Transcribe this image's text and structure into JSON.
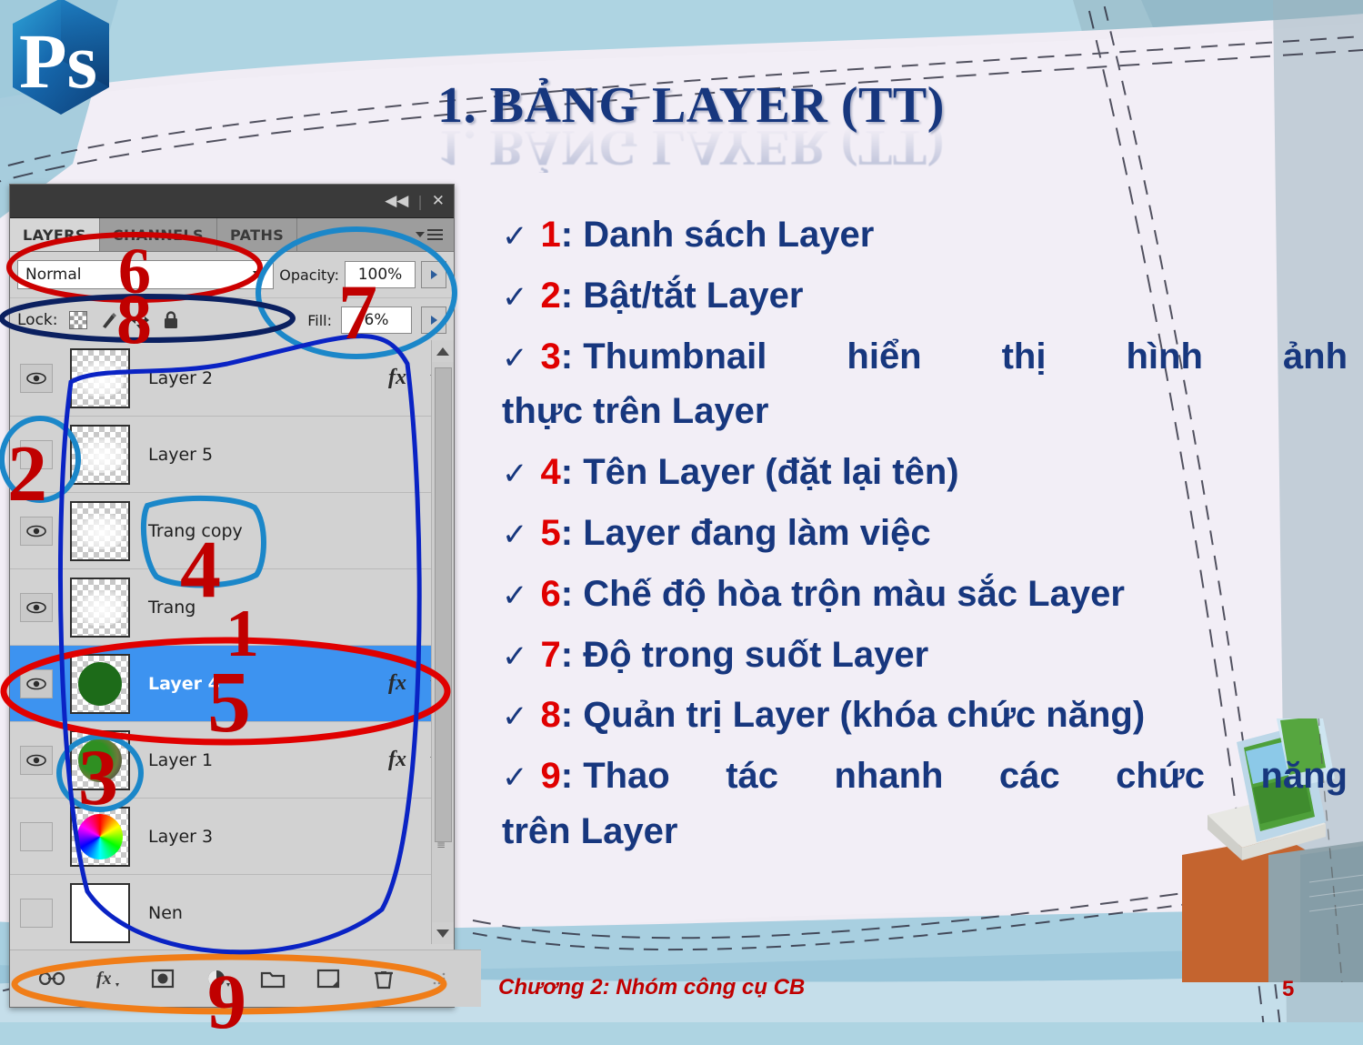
{
  "slide": {
    "title": "1. BẢNG LAYER (TT)",
    "footer": "Chương 2: Nhóm công cụ CB",
    "page_number": "5",
    "accent_blue": "#17377e",
    "accent_red": "#e00000",
    "bg_content": "#f0ecf4",
    "bg_band": "#aed4e2"
  },
  "logo": {
    "name": "photoshop-logo",
    "text": "Ps"
  },
  "panel": {
    "titlebar": {
      "collapse": "◀◀",
      "close": "✕"
    },
    "tabs": [
      {
        "label": "LAYERS",
        "active": true
      },
      {
        "label": "CHANNELS",
        "active": false
      },
      {
        "label": "PATHS",
        "active": false
      }
    ],
    "blend_mode": {
      "label": "Normal"
    },
    "opacity": {
      "label": "Opacity:",
      "value": "100%"
    },
    "fill": {
      "label": "Fill:",
      "value": "6%"
    },
    "lock": {
      "label": "Lock:",
      "icons": [
        "lock-transparent-pixels-icon",
        "lock-image-pixels-icon",
        "lock-position-icon",
        "lock-all-icon"
      ]
    },
    "layers": [
      {
        "name": "Layer 2",
        "visible": true,
        "selected": false,
        "fx": true,
        "thumb": "faint"
      },
      {
        "name": "Layer 5",
        "visible": false,
        "selected": false,
        "fx": false,
        "thumb": "faint"
      },
      {
        "name": "Trang copy",
        "visible": true,
        "selected": false,
        "fx": false,
        "thumb": "faint"
      },
      {
        "name": "Trang",
        "visible": true,
        "selected": false,
        "fx": false,
        "thumb": "faint"
      },
      {
        "name": "Layer 4",
        "visible": true,
        "selected": true,
        "fx": true,
        "thumb": "green-circle"
      },
      {
        "name": "Layer 1",
        "visible": true,
        "selected": false,
        "fx": true,
        "thumb": "green-dark-blob"
      },
      {
        "name": "Layer 3",
        "visible": false,
        "selected": false,
        "fx": false,
        "thumb": "color-wheel"
      },
      {
        "name": "Nen",
        "visible": false,
        "selected": false,
        "fx": false,
        "thumb": "white"
      }
    ],
    "fx_label": "fx",
    "bottom_buttons": [
      "link-layers-icon",
      "add-layer-style-icon",
      "add-layer-mask-icon",
      "new-adjustment-layer-icon",
      "new-group-icon",
      "new-layer-icon",
      "delete-layer-icon"
    ]
  },
  "annotations": [
    {
      "number": "1",
      "color": "#c00000",
      "shape": "red-ellipse-selected-row"
    },
    {
      "number": "2",
      "color": "#c00000",
      "shape": "blue-circle-eye-column"
    },
    {
      "number": "3",
      "color": "#c00000",
      "shape": "blue-circle-thumbnail"
    },
    {
      "number": "4",
      "color": "#c00000",
      "shape": "blue-circle-layer-name"
    },
    {
      "number": "5",
      "color": "#c00000",
      "shape": "red-ellipse-active-layer"
    },
    {
      "number": "6",
      "color": "#c00000",
      "shape": "red-ellipse-blend-mode"
    },
    {
      "number": "7",
      "color": "#c00000",
      "shape": "blue-ellipse-opacity-fill"
    },
    {
      "number": "8",
      "color": "#c00000",
      "shape": "navy-ellipse-lock-row"
    },
    {
      "number": "9",
      "color": "#c00000",
      "shape": "orange-ellipse-bottom-toolbar"
    }
  ],
  "bullets": [
    {
      "num": "1",
      "text": "Danh sách Layer",
      "justify": false
    },
    {
      "num": "2",
      "text": "Bật/tắt Layer",
      "justify": false
    },
    {
      "num": "3",
      "text": "Thumbnail hiển thị hình ảnh",
      "justify": true,
      "continuation": "thực trên Layer"
    },
    {
      "num": "4",
      "text": "Tên Layer (đặt lại tên)",
      "justify": false
    },
    {
      "num": "5",
      "text": "Layer đang làm việc",
      "justify": false
    },
    {
      "num": "6",
      "text": "Chế độ hòa trộn màu sắc Layer",
      "justify": false
    },
    {
      "num": "7",
      "text": "Độ trong suốt Layer",
      "justify": false
    },
    {
      "num": "8",
      "text": "Quản trị Layer (khóa chức năng)",
      "justify": false
    },
    {
      "num": "9",
      "text": "Thao tác nhanh các chức năng",
      "justify": true,
      "continuation": "trên Layer"
    }
  ],
  "icons": {
    "check": "✓",
    "eye": "eye-icon",
    "caret_down": "chevron-down-icon"
  }
}
